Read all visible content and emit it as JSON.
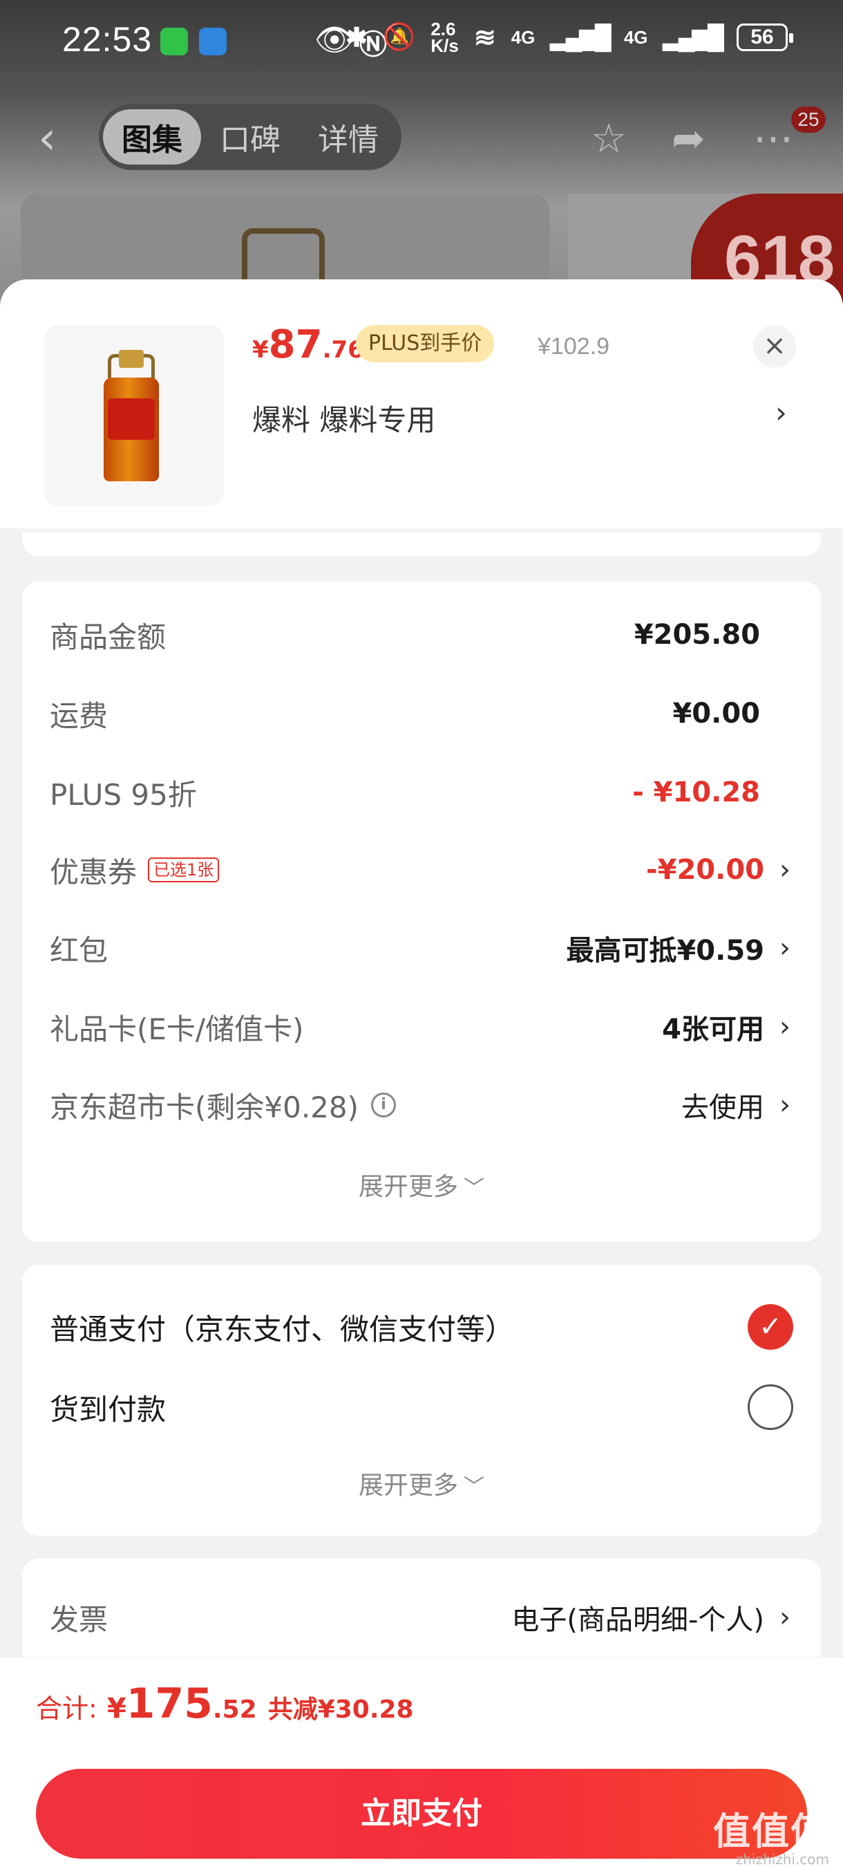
{
  "status_bar": {
    "time": "22:53",
    "network_speed": "2.6\nK/s",
    "signal_1": "4G",
    "signal_2": "4G",
    "battery": "56",
    "wifi_label": "6"
  },
  "nav": {
    "tabs": [
      {
        "label": "图集",
        "active": true
      },
      {
        "label": "口碑",
        "active": false
      },
      {
        "label": "详情",
        "active": false
      }
    ],
    "cart_badge": "25"
  },
  "background": {
    "promo_badge": "618"
  },
  "product": {
    "price_symbol": "¥",
    "price_integer": "87",
    "price_decimal": ".76",
    "plus_tag": "PLUS到手价",
    "original_price": "¥102.9",
    "spec": "爆料  爆料专用",
    "spec_arrow": "›",
    "close": "×"
  },
  "costs": {
    "rows": [
      {
        "label": "商品金额",
        "value": "¥205.80"
      },
      {
        "label": "运费",
        "value": "¥0.00"
      },
      {
        "label": "PLUS 95折",
        "value": "- ¥10.28"
      },
      {
        "label": "优惠券",
        "tag": "已选1张",
        "value": "-¥20.00"
      },
      {
        "label": "红包",
        "value": "最高可抵¥0.59"
      },
      {
        "label": "礼品卡(E卡/储值卡)",
        "value": "4张可用"
      },
      {
        "label": "京东超市卡(剩余¥0.28)",
        "value": "去使用"
      }
    ],
    "expand_more": "展开更多"
  },
  "payment": {
    "options": [
      {
        "label": "普通支付（京东支付、微信支付等）",
        "selected": true
      },
      {
        "label": "货到付款",
        "selected": false
      }
    ],
    "expand_more": "展开更多"
  },
  "invoice": {
    "label": "发票",
    "value": "电子(商品明细-个人)"
  },
  "total": {
    "label": "合计:",
    "symbol": "¥",
    "integer": "175",
    "decimal": ".52",
    "savings": "共减¥30.28"
  },
  "pay_button": "立即支付",
  "watermark": {
    "brand": "值值值",
    "domain": "zhizhizhi.com"
  },
  "colors": {
    "accent": "#e4322a",
    "plus_tag_bg": "#fde6a8"
  }
}
